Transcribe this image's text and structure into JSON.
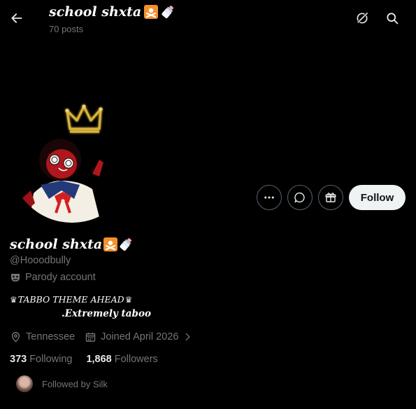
{
  "header": {
    "name": "school shxta",
    "posts": "70 posts"
  },
  "profile": {
    "display_name": "school shxta",
    "handle": "@Hooodbully",
    "parody_label": "Parody account",
    "bio_line1": "TABBO THEME AHEAD",
    "bio_line2": ".Extremely taboo",
    "location": "Tennessee",
    "joined": "Joined April 2026",
    "following_count": "373",
    "following_label": "Following",
    "followers_count": "1,868",
    "followers_label": "Followers",
    "followed_by": "Followed by Silk"
  },
  "actions": {
    "follow_label": "Follow"
  },
  "icons": {
    "back": "back-arrow-icon",
    "grok": "grok-icon",
    "search": "search-icon",
    "more": "more-icon",
    "message": "message-icon",
    "gift": "gift-icon",
    "parody": "parody-mask-icon",
    "location": "location-pin-icon",
    "calendar": "calendar-icon",
    "chevron": "chevron-right-icon"
  },
  "colors": {
    "background": "#000000",
    "text_primary": "#e7e9ea",
    "text_secondary": "#71767b",
    "border": "#536471",
    "follow_bg": "#eff3f4",
    "badge_orange": "#f5902b",
    "crown_gold": "#d9b33b"
  }
}
